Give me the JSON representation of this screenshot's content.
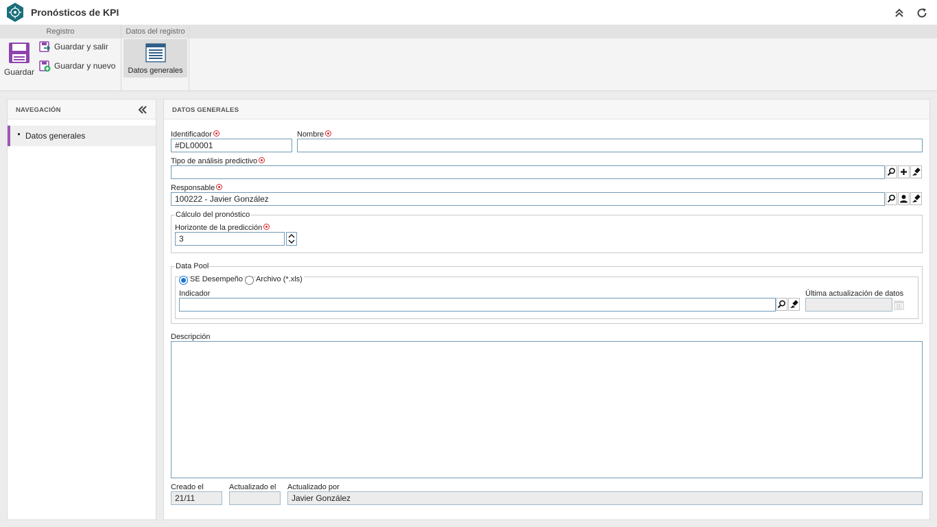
{
  "app": {
    "title": "Pronósticos de KPI"
  },
  "ribbon": {
    "group_registro": "Registro",
    "group_datos": "Datos del registro",
    "save_label": "Guardar",
    "save_exit_label": "Guardar y salir",
    "save_new_label": "Guardar y nuevo",
    "general_data_label": "Datos generales"
  },
  "navigation": {
    "title": "NAVEGACIÓN",
    "items": [
      {
        "label": "Datos generales",
        "selected": true
      }
    ]
  },
  "form": {
    "section_title": "DATOS GENERALES",
    "identifier_label": "Identificador",
    "identifier_value": "#DL00001",
    "name_label": "Nombre",
    "name_value": "",
    "analysis_type_label": "Tipo de análisis predictivo",
    "analysis_type_value": "",
    "responsible_label": "Responsable",
    "responsible_value": "100222 - Javier González",
    "forecast_group_label": "Cálculo del pronóstico",
    "horizon_label": "Horizonte de la predicción",
    "horizon_value": "3",
    "datapool_group_label": "Data Pool",
    "source_option_1": "SE Desempeño",
    "source_option_2": "Archivo (*.xls)",
    "selected_source": "SE Desempeño",
    "indicator_label": "Indicador",
    "indicator_value": "",
    "last_update_label": "Última actualización de datos",
    "last_update_value": "",
    "description_label": "Descripción",
    "description_value": "",
    "created_label": "Creado el",
    "created_value": "21/11",
    "updated_label": "Actualizado el",
    "updated_value": "",
    "updated_by_label": "Actualizado por",
    "updated_by_value": "Javier González"
  },
  "colors": {
    "brand": "#1b6f7a",
    "accent": "#9b59b6",
    "field_border": "#6f9bb5",
    "required": "#d9262b"
  },
  "icons": [
    "app-logo-icon",
    "collapse-up-icon",
    "refresh-icon",
    "save-icon",
    "save-exit-icon",
    "save-new-icon",
    "form-icon",
    "double-chevron-left-icon",
    "search-icon",
    "plus-icon",
    "eraser-icon",
    "user-icon",
    "calendar-icon",
    "spin-icon"
  ]
}
